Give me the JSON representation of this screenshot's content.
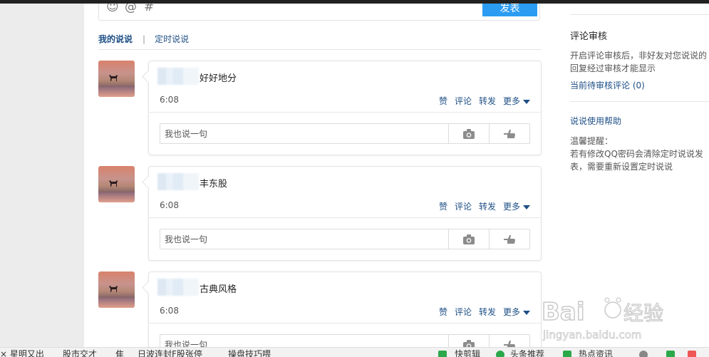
{
  "composer": {
    "emoji_icon": "☺",
    "at_icon": "@",
    "topic_icon": "#",
    "publish_label": "发表"
  },
  "tabs": {
    "mine": "我的说说",
    "separator": "|",
    "scheduled": "定时说说"
  },
  "posts": [
    {
      "text": "好好地分",
      "time": "6:08"
    },
    {
      "text": "丰东股",
      "time": "6:08"
    },
    {
      "text": "古典风格",
      "time": "6:08"
    }
  ],
  "actions": {
    "like": "赞",
    "comment": "评论",
    "forward": "转发",
    "more": "更多"
  },
  "reply": {
    "placeholder": "我也说一句"
  },
  "sidebar": {
    "review_title": "评论审核",
    "review_desc": "开启评论审核后，非好友对您说说的回复经过审核才能显示",
    "pending_link": "当前待审核评论 (0)",
    "help_link": "说说使用帮助",
    "tip_title": "温馨提醒：",
    "tip_text": "若有修改QQ密码会清除定时说说发表，需要重新设置定时说说"
  },
  "taskbar": {
    "items": [
      "× 星明又出",
      "股市交才",
      "隹",
      "日波连封F股张停",
      "操盘技巧喂",
      "快剪辑",
      "头条推荐",
      "热点资讯"
    ]
  },
  "watermark": {
    "brand": "Bai",
    "brand2": "经验",
    "url": "jingyan.baidu.com"
  }
}
